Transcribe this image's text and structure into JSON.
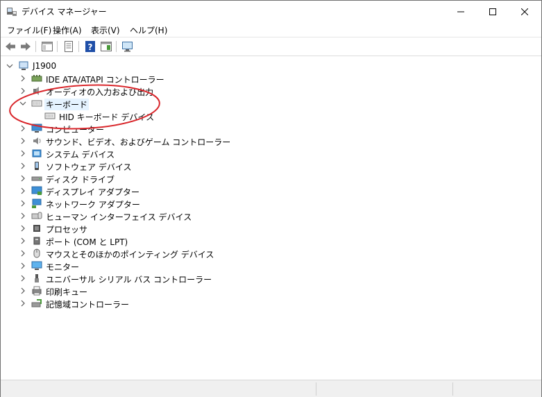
{
  "window": {
    "title": "デバイス マネージャー",
    "min_glyph": "—",
    "max_glyph": "☐",
    "close_glyph": "✕"
  },
  "menu": {
    "items": [
      {
        "label": "ファイル(F)"
      },
      {
        "label": "操作(A)"
      },
      {
        "label": "表示(V)"
      },
      {
        "label": "ヘルプ(H)"
      }
    ]
  },
  "toolbar": {
    "buttons": [
      "back-icon",
      "forward-icon",
      "show-hide-console-tree-icon",
      "properties-icon",
      "help-icon",
      "action-pane-icon",
      "scan-hardware-icon"
    ]
  },
  "tree": {
    "root": "J1900",
    "categories": [
      {
        "label": "IDE ATA/ATAPI コントローラー",
        "icon": "ide-controller-icon"
      },
      {
        "label": "オーディオの入力および出力",
        "icon": "audio-io-icon"
      },
      {
        "label": "キーボード",
        "icon": "keyboard-icon",
        "expanded": true,
        "selected": true,
        "children": [
          {
            "label": "HID キーボード デバイス",
            "icon": "keyboard-icon"
          }
        ]
      },
      {
        "label": "コンピューター",
        "icon": "computer-icon"
      },
      {
        "label": "サウンド、ビデオ、およびゲーム コントローラー",
        "icon": "sound-icon"
      },
      {
        "label": "システム デバイス",
        "icon": "system-device-icon"
      },
      {
        "label": "ソフトウェア デバイス",
        "icon": "software-device-icon"
      },
      {
        "label": "ディスク ドライブ",
        "icon": "disk-drive-icon"
      },
      {
        "label": "ディスプレイ アダプター",
        "icon": "display-adapter-icon"
      },
      {
        "label": "ネットワーク アダプター",
        "icon": "network-adapter-icon"
      },
      {
        "label": "ヒューマン インターフェイス デバイス",
        "icon": "hid-icon"
      },
      {
        "label": "プロセッサ",
        "icon": "processor-icon"
      },
      {
        "label": "ポート (COM と LPT)",
        "icon": "port-icon"
      },
      {
        "label": "マウスとそのほかのポインティング デバイス",
        "icon": "mouse-icon"
      },
      {
        "label": "モニター",
        "icon": "monitor-icon"
      },
      {
        "label": "ユニバーサル シリアル バス コントローラー",
        "icon": "usb-icon"
      },
      {
        "label": "印刷キュー",
        "icon": "print-queue-icon"
      },
      {
        "label": "記憶域コントローラー",
        "icon": "storage-controller-icon"
      }
    ]
  },
  "colors": {
    "annotation_ellipse": "#d9262b",
    "selection": "#e5f3ff"
  }
}
